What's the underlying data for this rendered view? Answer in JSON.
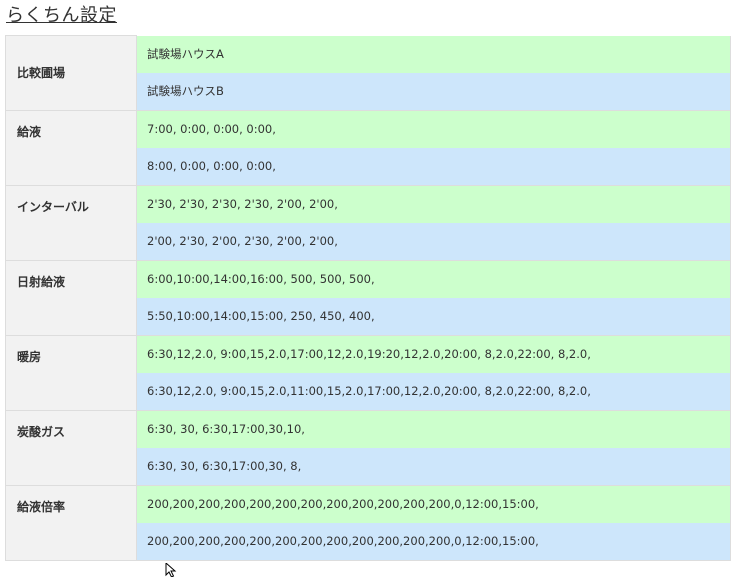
{
  "page": {
    "title": "らくちん設定"
  },
  "settings": [
    {
      "label": "比較圃場",
      "row_a": "試験場ハウスA",
      "row_b": "試験場ハウスB"
    },
    {
      "label": "給液",
      "row_a": "7:00, 0:00, 0:00, 0:00,",
      "row_b": "8:00, 0:00, 0:00, 0:00,"
    },
    {
      "label": "インターバル",
      "row_a": "2'30, 2'30, 2'30, 2'30, 2'00, 2'00,",
      "row_b": "2'00, 2'30, 2'00, 2'30, 2'00, 2'00,"
    },
    {
      "label": "日射給液",
      "row_a": "6:00,10:00,14:00,16:00, 500, 500, 500,",
      "row_b": "5:50,10:00,14:00,15:00, 250, 450, 400,"
    },
    {
      "label": "暖房",
      "row_a": "6:30,12,2.0, 9:00,15,2.0,17:00,12,2.0,19:20,12,2.0,20:00, 8,2.0,22:00, 8,2.0,",
      "row_b": "6:30,12,2.0, 9:00,15,2.0,11:00,15,2.0,17:00,12,2.0,20:00, 8,2.0,22:00, 8,2.0,"
    },
    {
      "label": "炭酸ガス",
      "row_a": "6:30, 30, 6:30,17:00,30,10,",
      "row_b": "6:30, 30, 6:30,17:00,30, 8,"
    },
    {
      "label": "給液倍率",
      "row_a": "200,200,200,200,200,200,200,200,200,200,200,200,0,12:00,15:00,",
      "row_b": "200,200,200,200,200,200,200,200,200,200,200,200,0,12:00,15:00,"
    }
  ],
  "colors": {
    "row_a_background": "#ccffcc",
    "row_b_background": "#cde6fb",
    "header_background": "#f2f2f2",
    "border": "#dddddd"
  },
  "icons": {
    "cursor": "mouse-pointer-icon"
  }
}
